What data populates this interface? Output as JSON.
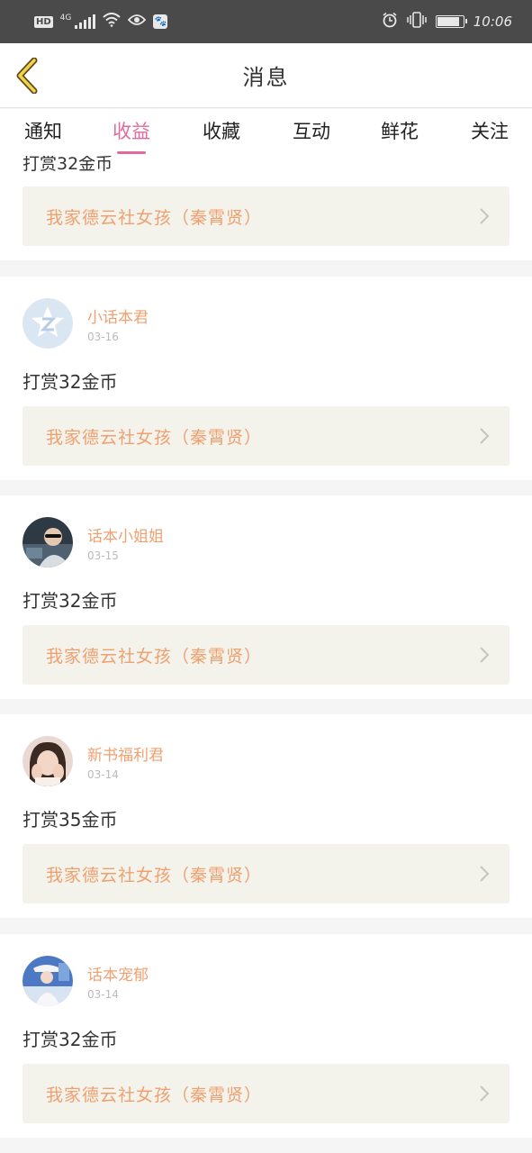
{
  "status_bar": {
    "hd": "HD",
    "network": "4G",
    "time": "10:06",
    "battery_level_percent": 90
  },
  "header": {
    "title": "消息"
  },
  "tabs": [
    {
      "label": "通知",
      "active": false
    },
    {
      "label": "收益",
      "active": true
    },
    {
      "label": "收藏",
      "active": false
    },
    {
      "label": "互动",
      "active": false
    },
    {
      "label": "鲜花",
      "active": false
    },
    {
      "label": "关注",
      "active": false
    }
  ],
  "feed": {
    "partial_card": {
      "reward": "打赏32金币",
      "book_title": "我家德云社女孩（秦霄贤）"
    },
    "items": [
      {
        "username": "小话本君",
        "date": "03-16",
        "reward": "打赏32金币",
        "book_title": "我家德云社女孩（秦霄贤）",
        "avatar": "logo-avatar"
      },
      {
        "username": "话本小姐姐",
        "date": "03-15",
        "reward": "打赏32金币",
        "book_title": "我家德云社女孩（秦霄贤）",
        "avatar": "photo-avatar"
      },
      {
        "username": "新书福利君",
        "date": "03-14",
        "reward": "打赏35金币",
        "book_title": "我家德云社女孩（秦霄贤）",
        "avatar": "photo-avatar"
      },
      {
        "username": "话本宠郁",
        "date": "03-14",
        "reward": "打赏32金币",
        "book_title": "我家德云社女孩（秦霄贤）",
        "avatar": "photo-avatar"
      }
    ]
  },
  "colors": {
    "accent": "#e06a9e",
    "username": "#f0a070",
    "status_bar_bg": "#4a4a4a",
    "book_link_bg": "#f3f3eb"
  }
}
